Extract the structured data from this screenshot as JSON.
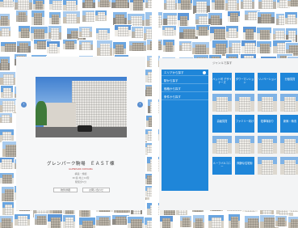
{
  "left_card": {
    "building_name": "グレンパーク駒場　ＥＡＳＴ棟",
    "subtitle": "GLENPARK KOMABA",
    "details": [
      "構造・規模",
      "RC造 地上12階",
      "駅徒歩5分"
    ],
    "links": [
      "物件詳細",
      "お問い合わせ"
    ]
  },
  "right_panel": {
    "header": "ジャンルで探す",
    "sidebar_items": [
      "エリアから探す",
      "駅から探す",
      "価格から探す",
      "条件から探す"
    ],
    "categories": [
      {
        "label": "ペット可\nデザイナーズ"
      },
      {
        "label": "タワーマンション"
      },
      {
        "label": "リノベーション"
      },
      {
        "label": "分譲賃貸"
      },
      {
        "label": "高級賃貸"
      },
      {
        "label": "ファミリー向け"
      },
      {
        "label": "駐車場あり"
      },
      {
        "label": "新築・築浅"
      },
      {
        "label": "ルーフバルコニー"
      },
      {
        "label": "閑静な住宅街"
      }
    ]
  },
  "colors": {
    "accent": "#1f86d9",
    "panel_bg": "#f6f7f8"
  }
}
